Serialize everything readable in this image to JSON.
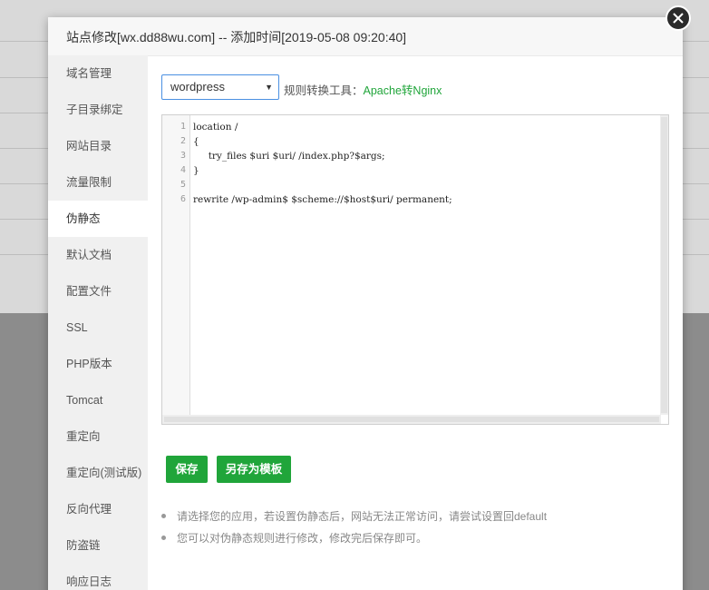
{
  "dialog": {
    "title": "站点修改[wx.dd88wu.com] -- 添加时间[2019-05-08 09:20:40]"
  },
  "sidebar": {
    "items": [
      {
        "label": "域名管理"
      },
      {
        "label": "子目录绑定"
      },
      {
        "label": "网站目录"
      },
      {
        "label": "流量限制"
      },
      {
        "label": "伪静态",
        "active": true
      },
      {
        "label": "默认文档"
      },
      {
        "label": "配置文件"
      },
      {
        "label": "SSL"
      },
      {
        "label": "PHP版本"
      },
      {
        "label": "Tomcat"
      },
      {
        "label": "重定向"
      },
      {
        "label": "重定向(测试版)"
      },
      {
        "label": "反向代理"
      },
      {
        "label": "防盗链"
      },
      {
        "label": "响应日志"
      }
    ]
  },
  "rewrite": {
    "selected_template": "wordpress",
    "tool_label": "规则转换工具：",
    "tool_link": "Apache转Nginx"
  },
  "editor": {
    "line_numbers": [
      "1",
      "2",
      "3",
      "4",
      "5",
      "6"
    ],
    "lines": [
      "location /",
      "{",
      "     try_files $uri $uri/ /index.php?$args;",
      "}",
      "",
      "rewrite /wp-admin$ $scheme://$host$uri/ permanent;"
    ]
  },
  "actions": {
    "save_label": "保存",
    "save_template_label": "另存为模板"
  },
  "tips": [
    "请选择您的应用，若设置伪静态后，网站无法正常访问，请尝试设置回default",
    "您可以对伪静态规则进行修改，修改完后保存即可。"
  ],
  "colors": {
    "accent": "#20a53a",
    "select_border": "#4a90e2"
  }
}
